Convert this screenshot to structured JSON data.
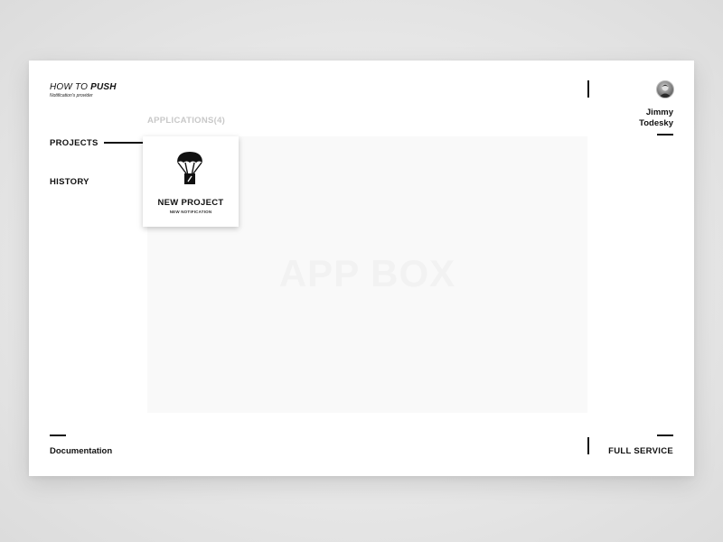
{
  "brand": {
    "title_prefix": "HOW TO ",
    "title_strong": "PUSH",
    "subtitle": "Notification's provider"
  },
  "nav": {
    "projects": "PROJECTS",
    "history": "HISTORY"
  },
  "main": {
    "applications_label": "APPLICATIONS(4)",
    "app_box_placeholder": "APP BOX",
    "card": {
      "title": "NEW PROJECT",
      "subtitle": "NEW NOTIFICATION",
      "icon": "parachute-icon"
    }
  },
  "user": {
    "first_name": "Jimmy",
    "last_name": "Todesky",
    "avatar": "avatar-photo"
  },
  "footer": {
    "documentation": "Documentation",
    "full_service": "FULL SERVICE"
  }
}
